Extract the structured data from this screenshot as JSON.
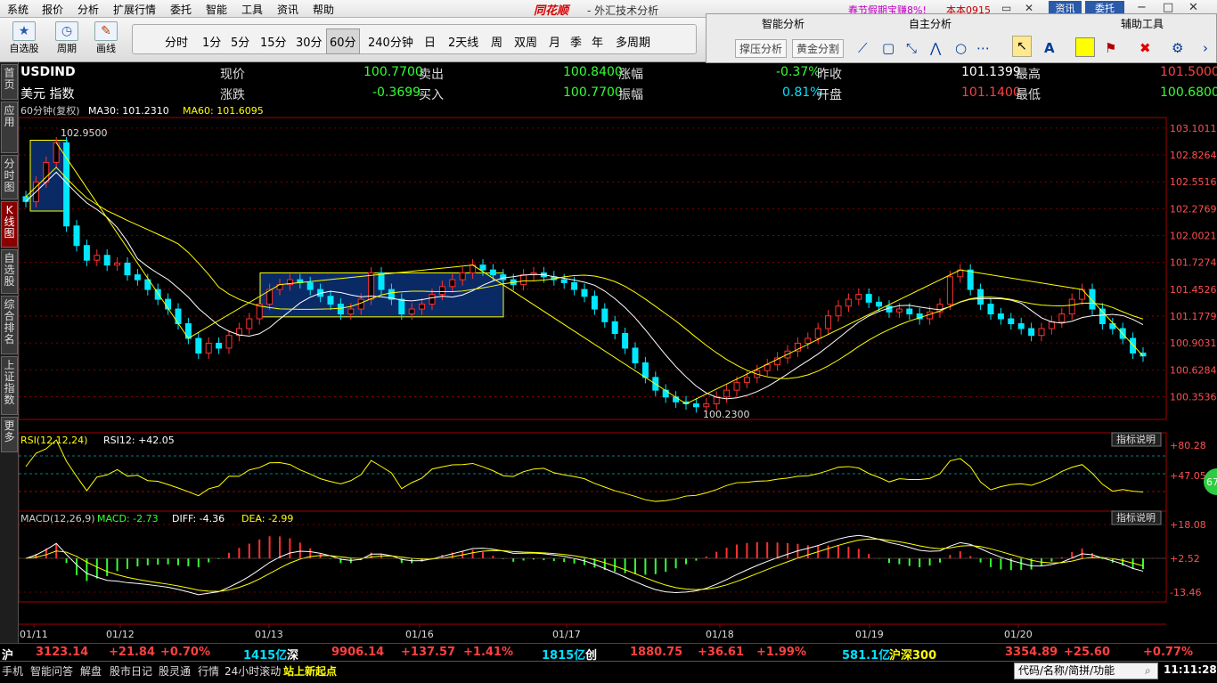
{
  "menu": [
    "系统",
    "报价",
    "分析",
    "扩展行情",
    "委托",
    "智能",
    "工具",
    "资讯",
    "帮助"
  ],
  "brand": {
    "name": "同花顺",
    "sub": "- 外汇技术分析",
    "promo": "春节假期宝赚8%!",
    "user": "本本0915",
    "btn1": "资讯",
    "btn2": "委托"
  },
  "toolbar": {
    "zixuan": "自选股",
    "zhouqi": "周期",
    "huaxian": "画线",
    "periods": [
      "分时",
      "1分",
      "5分",
      "15分",
      "30分",
      "60分",
      "240分钟",
      "日",
      "2天线",
      "周",
      "双周",
      "月",
      "季",
      "年",
      "多周期"
    ],
    "active_period": "60分"
  },
  "analysis": {
    "smart": "智能分析",
    "self": "自主分析",
    "aux": "辅助工具",
    "btn_zy": "撑压分析",
    "btn_hj": "黄金分割",
    "aux_text": "A"
  },
  "sidebar": [
    "首页",
    "应用",
    "分时图",
    "K线图",
    "自选股",
    "综合排名",
    "上证指数",
    "更多"
  ],
  "quote": {
    "code": "USDIND",
    "name": "美元 指数",
    "now_l": "现价",
    "now": "100.7700",
    "sell_l": "卖出",
    "sell": "100.8400",
    "zf_l": "涨幅",
    "zf": "-0.37%",
    "zs_l": "昨收",
    "zs": "101.1399",
    "zg_l": "最高",
    "zg": "101.5000",
    "zd_l": "涨跌",
    "zd": "-0.3699",
    "buy_l": "买入",
    "buy": "100.7700",
    "zhenf_l": "振幅",
    "zhenf": "0.81%",
    "kp_l": "开盘",
    "kp": "101.1400",
    "zdi_l": "最低",
    "zdi": "100.6800"
  },
  "kline": {
    "header": "60分钟(复权)",
    "ma30": "MA30: 101.2310",
    "ma60": "MA60: 101.6095",
    "high_label": "102.9500",
    "low_label": "100.2300",
    "yticks": [
      "103.1011",
      "102.8264",
      "102.5516",
      "102.2769",
      "102.0021",
      "101.7274",
      "101.4526",
      "101.1779",
      "100.9031",
      "100.6284",
      "100.3536"
    ]
  },
  "rsi": {
    "label": "RSI(12,12,24)",
    "value": "RSI12: +42.05",
    "btn": "指标说明",
    "yticks": [
      "+80.28",
      "+47.05"
    ]
  },
  "macd": {
    "label": "MACD(12,26,9)",
    "macd": "MACD: -2.73",
    "diff": "DIFF: -4.36",
    "dea": "DEA: -2.99",
    "btn": "指标说明",
    "yticks": [
      "+18.08",
      "+2.52",
      "-13.46"
    ]
  },
  "dates": [
    "01/11",
    "01/12",
    "01/13",
    "01/16",
    "01/17",
    "01/18",
    "01/19",
    "01/20"
  ],
  "ticker": [
    {
      "k": "沪",
      "v": "3123.14",
      "c": "+21.84",
      "p": "+0.70%",
      "amt": "1415亿"
    },
    {
      "k": "深",
      "v": "9906.14",
      "c": "+137.57",
      "p": "+1.41%",
      "amt": "1815亿"
    },
    {
      "k": "创",
      "v": "1880.75",
      "c": "+36.61",
      "p": "+1.99%",
      "amt": "581.1亿"
    },
    {
      "k": "沪深300",
      "v": "3354.89",
      "c": "+25.60",
      "p": "+0.77%"
    }
  ],
  "status": {
    "items": [
      "手机",
      "智能问答",
      "解盘",
      "股市日记",
      "股灵通",
      "行情",
      "24小时滚动"
    ],
    "news": "站上新起点",
    "search": "代码/名称/简拼/功能",
    "time": "11:11:28"
  },
  "badge": "67",
  "chart_data": {
    "type": "candlestick",
    "title": "USDIND 60分钟",
    "ylim": [
      100.23,
      103.1
    ],
    "high": 102.95,
    "low": 100.23,
    "closes": [
      102.35,
      102.55,
      102.75,
      102.95,
      102.1,
      101.9,
      101.75,
      101.8,
      101.7,
      101.72,
      101.6,
      101.55,
      101.45,
      101.35,
      101.25,
      101.1,
      100.95,
      100.8,
      100.9,
      100.85,
      100.98,
      101.05,
      101.15,
      101.3,
      101.45,
      101.5,
      101.55,
      101.52,
      101.45,
      101.38,
      101.3,
      101.2,
      101.25,
      101.35,
      101.62,
      101.45,
      101.35,
      101.2,
      101.25,
      101.3,
      101.4,
      101.48,
      101.55,
      101.62,
      101.7,
      101.65,
      101.6,
      101.55,
      101.5,
      101.6,
      101.62,
      101.58,
      101.55,
      101.52,
      101.45,
      101.38,
      101.25,
      101.12,
      101.0,
      100.85,
      100.7,
      100.55,
      100.42,
      100.35,
      100.3,
      100.28,
      100.25,
      100.28,
      100.35,
      100.42,
      100.5,
      100.55,
      100.62,
      100.68,
      100.75,
      100.82,
      100.9,
      100.95,
      101.05,
      101.18,
      101.28,
      101.35,
      101.4,
      101.32,
      101.28,
      101.22,
      101.25,
      101.2,
      101.15,
      101.22,
      101.3,
      101.58,
      101.65,
      101.45,
      101.3,
      101.2,
      101.15,
      101.1,
      101.05,
      100.98,
      101.05,
      101.12,
      101.2,
      101.35,
      101.45,
      101.25,
      101.1,
      101.05,
      100.95,
      100.8,
      100.77
    ]
  }
}
